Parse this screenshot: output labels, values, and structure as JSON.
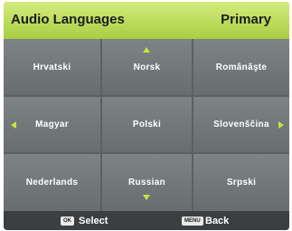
{
  "header": {
    "title": "Audio Languages",
    "selected_value": "Primary"
  },
  "languages": [
    [
      "Hrvatski",
      "Norsk",
      "Românăşte"
    ],
    [
      "Magyar",
      "Polski",
      "Slovenščina"
    ],
    [
      "Nederlands",
      "Russian",
      "Srpski"
    ]
  ],
  "footer": {
    "ok_key": "OK",
    "ok_label": "Select",
    "menu_key": "MENU",
    "menu_label": "Back"
  },
  "icons": {
    "scroll_up": "triangle-up-icon",
    "scroll_down": "triangle-down-icon",
    "scroll_left": "triangle-left-icon",
    "scroll_right": "triangle-right-icon"
  },
  "colors": {
    "header_top": "#d4ec7e",
    "header_bottom": "#a9cd42",
    "cell": "#767b7e",
    "footer": "#3c3f41",
    "arrow": "#c7e43a"
  }
}
